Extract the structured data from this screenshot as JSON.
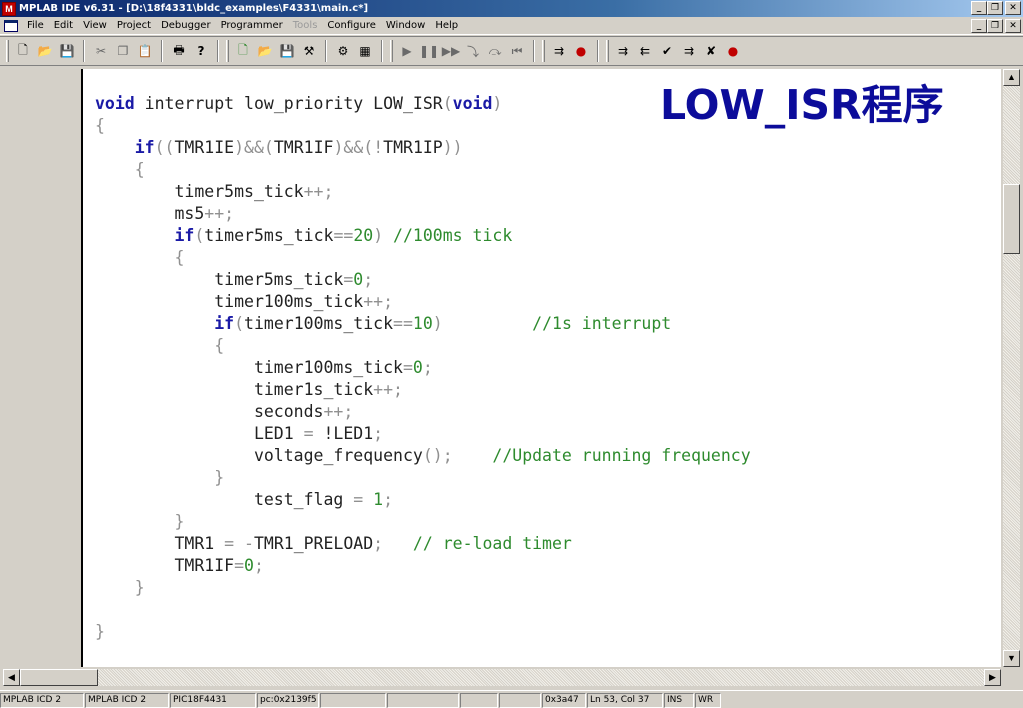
{
  "titlebar": {
    "app_icon": "mplab-icon",
    "title": "MPLAB IDE v6.31 - [D:\\18f4331\\bldc_examples\\F4331\\main.c*]",
    "buttons": [
      "minimize",
      "restore",
      "close"
    ]
  },
  "menubar": {
    "items": [
      "File",
      "Edit",
      "View",
      "Project",
      "Debugger",
      "Programmer",
      "Tools",
      "Configure",
      "Window",
      "Help"
    ],
    "disabled": [
      "Tools"
    ]
  },
  "toolbar": {
    "groups": [
      [
        "new-file-icon",
        "open-icon",
        "save-icon"
      ],
      [
        "cut-icon",
        "copy-icon",
        "paste-icon"
      ],
      [
        "print-icon",
        "help-icon"
      ],
      [
        "new-project-icon",
        "open-project-icon",
        "save-project-icon",
        "build-icon",
        "find-icon",
        "build-all-icon"
      ],
      [
        "run-icon",
        "halt-icon",
        "animate-icon",
        "step-into-icon",
        "step-over-icon",
        "reset-icon"
      ],
      [
        "program-icon",
        "read-icon"
      ],
      [
        "icd-download-icon",
        "icd-upload-icon",
        "icd-verify-icon",
        "icd-erase-icon",
        "icd-blank-icon",
        "icd-connect-icon"
      ]
    ]
  },
  "editor": {
    "overlay_title": "LOW_ISR程序",
    "code": [
      [
        {
          "t": "void",
          "c": "kw"
        },
        {
          "t": " interrupt low_priority LOW_ISR"
        },
        {
          "t": "(",
          "c": "op"
        },
        {
          "t": "void",
          "c": "kw"
        },
        {
          "t": ")",
          "c": "op"
        }
      ],
      [
        {
          "t": "{",
          "c": "op"
        }
      ],
      [
        {
          "t": "    "
        },
        {
          "t": "if",
          "c": "kw"
        },
        {
          "t": "((",
          "c": "op"
        },
        {
          "t": "TMR1IE"
        },
        {
          "t": ")&&(",
          "c": "op"
        },
        {
          "t": "TMR1IF"
        },
        {
          "t": ")&&(!",
          "c": "op"
        },
        {
          "t": "TMR1IP"
        },
        {
          "t": "))",
          "c": "op"
        }
      ],
      [
        {
          "t": "    "
        },
        {
          "t": "{",
          "c": "op"
        }
      ],
      [
        {
          "t": "        timer5ms_tick"
        },
        {
          "t": "++;",
          "c": "op"
        }
      ],
      [
        {
          "t": "        ms5"
        },
        {
          "t": "++;",
          "c": "op"
        }
      ],
      [
        {
          "t": "        "
        },
        {
          "t": "if",
          "c": "kw"
        },
        {
          "t": "(",
          "c": "op"
        },
        {
          "t": "timer5ms_tick"
        },
        {
          "t": "==",
          "c": "op"
        },
        {
          "t": "20",
          "c": "num"
        },
        {
          "t": ")",
          "c": "op"
        },
        {
          "t": " //100ms tick",
          "c": "cm"
        }
      ],
      [
        {
          "t": "        "
        },
        {
          "t": "{",
          "c": "op"
        }
      ],
      [
        {
          "t": "            timer5ms_tick"
        },
        {
          "t": "=",
          "c": "op"
        },
        {
          "t": "0",
          "c": "num"
        },
        {
          "t": ";",
          "c": "op"
        }
      ],
      [
        {
          "t": "            timer100ms_tick"
        },
        {
          "t": "++;",
          "c": "op"
        }
      ],
      [
        {
          "t": "            "
        },
        {
          "t": "if",
          "c": "kw"
        },
        {
          "t": "(",
          "c": "op"
        },
        {
          "t": "timer100ms_tick"
        },
        {
          "t": "==",
          "c": "op"
        },
        {
          "t": "10",
          "c": "num"
        },
        {
          "t": ")",
          "c": "op"
        },
        {
          "t": "         "
        },
        {
          "t": "//1s interrupt",
          "c": "cm"
        }
      ],
      [
        {
          "t": "            "
        },
        {
          "t": "{",
          "c": "op"
        }
      ],
      [
        {
          "t": "                timer100ms_tick"
        },
        {
          "t": "=",
          "c": "op"
        },
        {
          "t": "0",
          "c": "num"
        },
        {
          "t": ";",
          "c": "op"
        }
      ],
      [
        {
          "t": "                timer1s_tick"
        },
        {
          "t": "++;",
          "c": "op"
        }
      ],
      [
        {
          "t": "                seconds"
        },
        {
          "t": "++;",
          "c": "op"
        }
      ],
      [
        {
          "t": "                LED1 "
        },
        {
          "t": "=",
          "c": "op"
        },
        {
          "t": " !LED1"
        },
        {
          "t": ";",
          "c": "op"
        }
      ],
      [
        {
          "t": "                voltage_frequency"
        },
        {
          "t": "();",
          "c": "op"
        },
        {
          "t": "    "
        },
        {
          "t": "//Update running frequency",
          "c": "cm"
        }
      ],
      [
        {
          "t": "            "
        },
        {
          "t": "}",
          "c": "op"
        }
      ],
      [
        {
          "t": "                test_flag "
        },
        {
          "t": "=",
          "c": "op"
        },
        {
          "t": " "
        },
        {
          "t": "1",
          "c": "num"
        },
        {
          "t": ";",
          "c": "op"
        }
      ],
      [
        {
          "t": "        "
        },
        {
          "t": "}",
          "c": "op"
        }
      ],
      [
        {
          "t": "        TMR1 "
        },
        {
          "t": "=",
          "c": "op"
        },
        {
          "t": " "
        },
        {
          "t": "-",
          "c": "op"
        },
        {
          "t": "TMR1_PRELOAD"
        },
        {
          "t": ";",
          "c": "op"
        },
        {
          "t": "   "
        },
        {
          "t": "// re-load timer",
          "c": "cm"
        }
      ],
      [
        {
          "t": "        TMR1IF"
        },
        {
          "t": "=",
          "c": "op"
        },
        {
          "t": "0",
          "c": "num"
        },
        {
          "t": ";",
          "c": "op"
        }
      ],
      [
        {
          "t": "    "
        },
        {
          "t": "}",
          "c": "op"
        }
      ],
      [
        {
          "t": ""
        }
      ],
      [
        {
          "t": "}",
          "c": "op"
        }
      ]
    ]
  },
  "statusbar": {
    "cells": [
      "MPLAB ICD 2",
      "MPLAB ICD 2",
      "PIC18F4431",
      "pc:0x2139f5",
      "",
      "",
      "",
      "",
      "0x3a47",
      "Ln 53, Col 37",
      "INS",
      "WR"
    ]
  }
}
